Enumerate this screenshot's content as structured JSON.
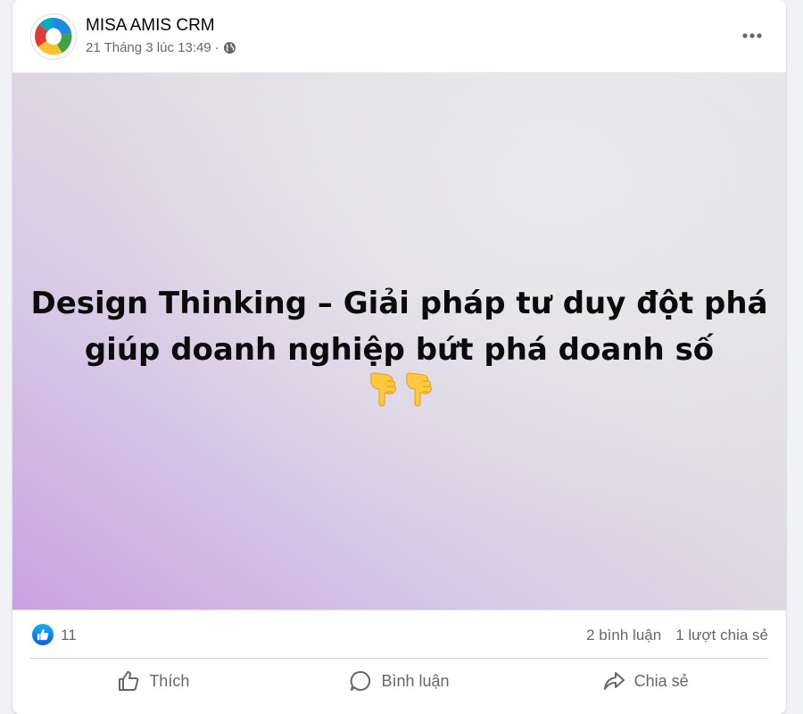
{
  "post": {
    "author": "MISA AMIS CRM",
    "timestamp": "21 Tháng 3 lúc 13:49",
    "separator": "·",
    "privacy_icon": "globe-icon",
    "image_text_line1": "Design Thinking – Giải pháp tư duy đột phá",
    "image_text_line2": "giúp doanh nghiệp bứt phá doanh số",
    "image_emoji": "backhand-index-pointing-down-icon",
    "background_colors": [
      "#c9a2e0",
      "#e4e4e6"
    ]
  },
  "stats": {
    "reaction_icon": "like-icon",
    "like_count": "11",
    "comments": "2 bình luận",
    "shares": "1 lượt chia sẻ"
  },
  "actions": {
    "like": "Thích",
    "comment": "Bình luận",
    "share": "Chia sẻ"
  },
  "colors": {
    "like_blue": "#0866ff",
    "secondary_text": "#65676b"
  }
}
